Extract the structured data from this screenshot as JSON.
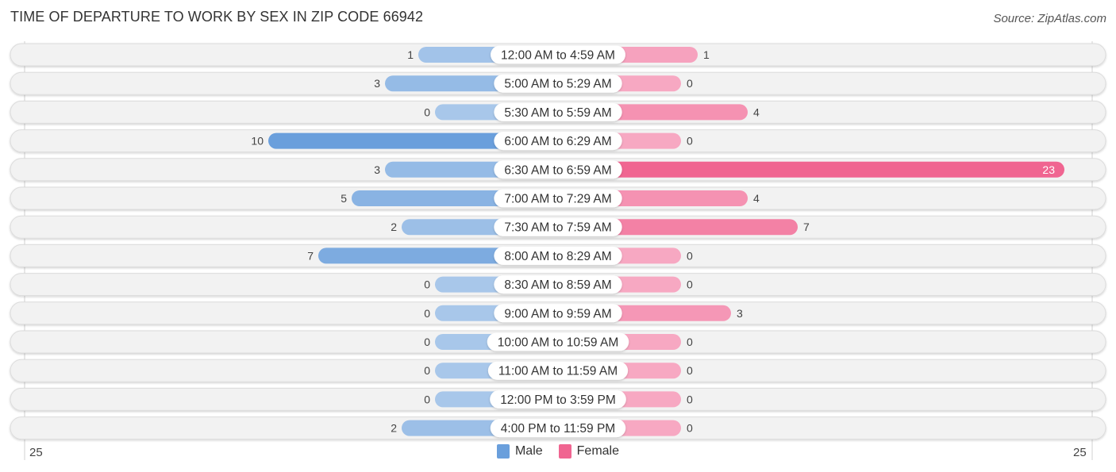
{
  "header": {
    "title": "TIME OF DEPARTURE TO WORK BY SEX IN ZIP CODE 66942",
    "source": "Source: ZipAtlas.com"
  },
  "legend": [
    {
      "label": "Male",
      "color": "#6a9fdc"
    },
    {
      "label": "Female",
      "color": "#f06591"
    }
  ],
  "axis": {
    "left_label": "25",
    "right_label": "25"
  },
  "colors": {
    "male_strong": "#6a9fdc",
    "male_light": "#a8c7ea",
    "female_strong": "#f06591",
    "female_light": "#f7a8c2",
    "row_bg": "#f2f2f2"
  },
  "chart_data": {
    "type": "bar",
    "orientation": "horizontal-diverging",
    "title": "TIME OF DEPARTURE TO WORK BY SEX IN ZIP CODE 66942",
    "xlim": [
      -25,
      25
    ],
    "categories": [
      "12:00 AM to 4:59 AM",
      "5:00 AM to 5:29 AM",
      "5:30 AM to 5:59 AM",
      "6:00 AM to 6:29 AM",
      "6:30 AM to 6:59 AM",
      "7:00 AM to 7:29 AM",
      "7:30 AM to 7:59 AM",
      "8:00 AM to 8:29 AM",
      "8:30 AM to 8:59 AM",
      "9:00 AM to 9:59 AM",
      "10:00 AM to 10:59 AM",
      "11:00 AM to 11:59 AM",
      "12:00 PM to 3:59 PM",
      "4:00 PM to 11:59 PM"
    ],
    "series": [
      {
        "name": "Male",
        "values": [
          1,
          3,
          0,
          10,
          3,
          5,
          2,
          7,
          0,
          0,
          0,
          0,
          0,
          2
        ]
      },
      {
        "name": "Female",
        "values": [
          1,
          0,
          4,
          0,
          23,
          4,
          7,
          0,
          0,
          3,
          0,
          0,
          0,
          0
        ]
      }
    ],
    "legend_position": "bottom-center"
  }
}
